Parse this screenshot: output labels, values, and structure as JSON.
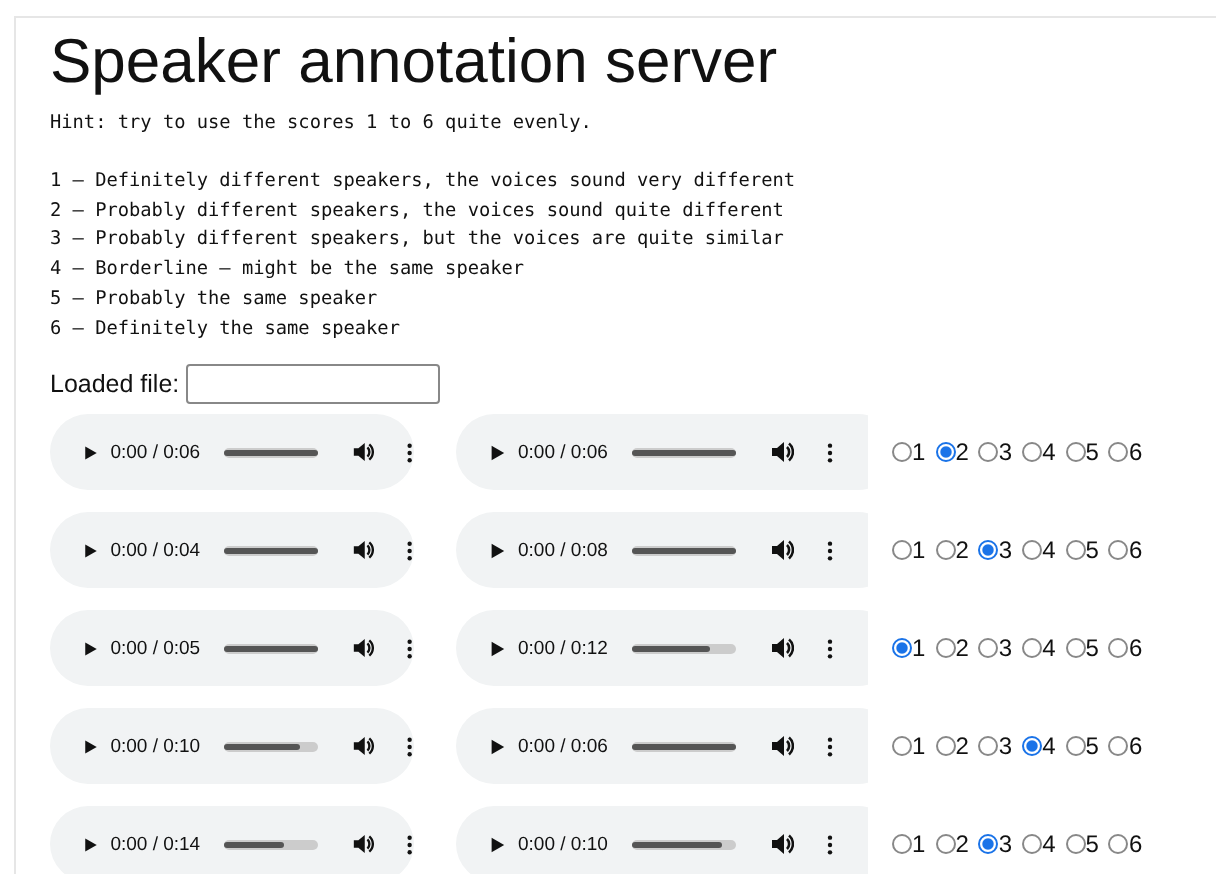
{
  "title": "Speaker annotation server",
  "hint": "Hint: try to use the scores 1 to 6 quite evenly.",
  "scale": [
    "1 – Definitely different speakers, the voices sound very different",
    "2 – Probably different speakers, the voices sound quite different",
    "3 – Probably different speakers, but the voices are quite similar",
    "4 – Borderline – might be the same speaker",
    "5 – Probably the same speaker",
    "6 – Definitely the same speaker"
  ],
  "loaded_file": {
    "label": "Loaded file:"
  },
  "rows": [
    {
      "players": [
        {
          "time": "0:00 / 0:06",
          "level": 1
        },
        {
          "time": "0:00 / 0:06",
          "level": 1
        }
      ],
      "options": [
        {
          "label": "1",
          "selected": false
        },
        {
          "label": "2",
          "selected": true
        },
        {
          "label": "3",
          "selected": false
        },
        {
          "label": "4",
          "selected": false
        },
        {
          "label": "5",
          "selected": false
        },
        {
          "label": "6",
          "selected": false
        }
      ]
    },
    {
      "players": [
        {
          "time": "0:00 / 0:04",
          "level": 1
        },
        {
          "time": "0:00 / 0:08",
          "level": 1
        }
      ],
      "options": [
        {
          "label": "1",
          "selected": false
        },
        {
          "label": "2",
          "selected": false
        },
        {
          "label": "3",
          "selected": true
        },
        {
          "label": "4",
          "selected": false
        },
        {
          "label": "5",
          "selected": false
        },
        {
          "label": "6",
          "selected": false
        }
      ]
    },
    {
      "players": [
        {
          "time": "0:00 / 0:05",
          "level": 1
        },
        {
          "time": "0:00 / 0:12",
          "level": 0.76
        }
      ],
      "options": [
        {
          "label": "1",
          "selected": true
        },
        {
          "label": "2",
          "selected": false
        },
        {
          "label": "3",
          "selected": false
        },
        {
          "label": "4",
          "selected": false
        },
        {
          "label": "5",
          "selected": false
        },
        {
          "label": "6",
          "selected": false
        }
      ]
    },
    {
      "players": [
        {
          "time": "0:00 / 0:10",
          "level": 0.81
        },
        {
          "time": "0:00 / 0:06",
          "level": 1
        }
      ],
      "options": [
        {
          "label": "1",
          "selected": false
        },
        {
          "label": "2",
          "selected": false
        },
        {
          "label": "3",
          "selected": false
        },
        {
          "label": "4",
          "selected": true
        },
        {
          "label": "5",
          "selected": false
        },
        {
          "label": "6",
          "selected": false
        }
      ]
    },
    {
      "players": [
        {
          "time": "0:00 / 0:14",
          "level": 0.63
        },
        {
          "time": "0:00 / 0:10",
          "level": 0.86
        }
      ],
      "options": [
        {
          "label": "1",
          "selected": false
        },
        {
          "label": "2",
          "selected": false
        },
        {
          "label": "3",
          "selected": true
        },
        {
          "label": "4",
          "selected": false
        },
        {
          "label": "5",
          "selected": false
        },
        {
          "label": "6",
          "selected": false
        }
      ]
    }
  ]
}
